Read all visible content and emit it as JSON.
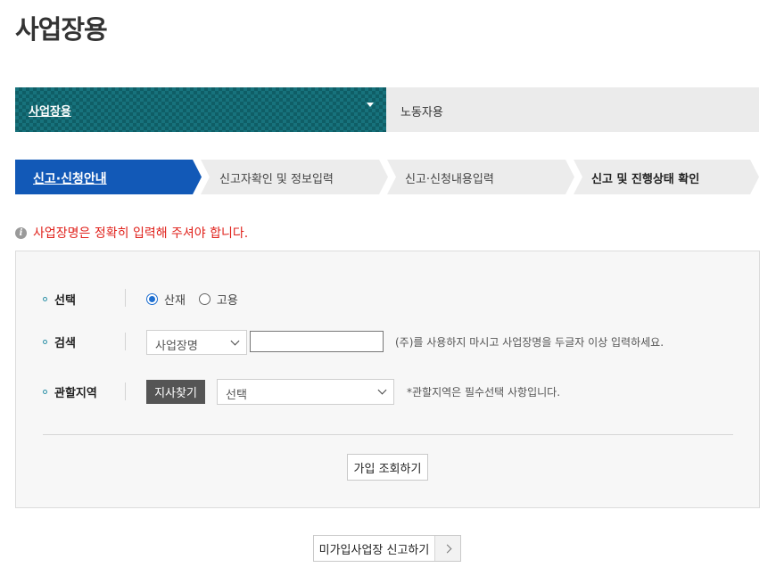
{
  "page": {
    "title": "사업장용"
  },
  "top_tabs": [
    {
      "label": "사업장용",
      "active": true
    },
    {
      "label": "노동자용",
      "active": false
    }
  ],
  "steps": [
    {
      "label": "신고·신청안내",
      "active": true
    },
    {
      "label": "신고자확인 및 정보입력",
      "active": false
    },
    {
      "label": "신고·신청내용입력",
      "active": false
    },
    {
      "label": "신고 및 진행상태 확인",
      "active": false
    }
  ],
  "notice": {
    "text": "사업장명은 정확히 입력해 주셔야 합니다."
  },
  "form": {
    "select_label": "선택",
    "radio_options": [
      {
        "label": "산재",
        "checked": true
      },
      {
        "label": "고용",
        "checked": false
      }
    ],
    "search_label": "검색",
    "search_type_value": "사업장명",
    "search_input_value": "",
    "search_hint": "(주)를 사용하지 마시고 사업장명을 두글자 이상 입력하세요.",
    "region_label": "관할지역",
    "branch_button": "지사찾기",
    "region_select_value": "선택",
    "region_hint": "*관할지역은 필수선택 사항입니다.",
    "lookup_button": "가입 조회하기"
  },
  "report_button": "미가입사업장 신고하기",
  "colors": {
    "teal_tab": "#17727c",
    "step_active": "#1259b7",
    "warning_text": "#e0221c",
    "radio_checked": "#1f6fd0"
  },
  "icons": {
    "info": "info-icon",
    "dropdown": "chevron-down-icon",
    "next": "chevron-right-icon"
  }
}
